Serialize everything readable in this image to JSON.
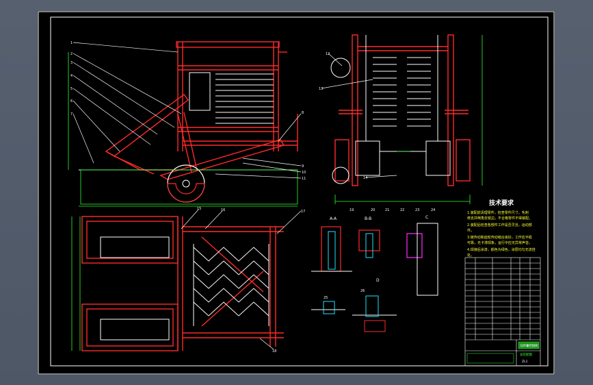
{
  "drawing": {
    "views": {
      "section_a": {
        "label": "A-A"
      },
      "section_b": {
        "label": "B-B"
      },
      "detail_c": {
        "label": "C"
      },
      "detail_d": {
        "label": "D"
      }
    },
    "notes": {
      "title": "技术要求",
      "lines": [
        "1.装配前清理零件，检查零件尺寸，毛刺",
        "修去并倒角去锐边，不合格零件不得装配。",
        "2.装配后检查各部件工作是否灵活，运动部",
        "件。",
        "3.链传动和齿轮传动啮合良好，工作应平稳",
        "可靠，无卡滞现象，运行中应无异常声音。",
        "4.焊接后涂漆，颜色为绿色，涂层均匀无流挂",
        "处。"
      ]
    },
    "balloons": [
      "1",
      "2",
      "3",
      "4",
      "5",
      "6",
      "7",
      "8",
      "9",
      "10",
      "11",
      "12",
      "13",
      "14",
      "15",
      "16",
      "17",
      "18",
      "19",
      "20",
      "21",
      "22",
      "23",
      "24",
      "25",
      "26"
    ],
    "title_block": {
      "title_1": "马铃薯挖掘机",
      "title_2": "总装配图",
      "sheet_no": "ZL1"
    },
    "colors": {
      "frame": "#ffffff",
      "structure": "#ff2a2a",
      "outline": "#ffffff",
      "dim": "#2cff2c",
      "leader": "#ffffff",
      "hatch": "#ff2cff",
      "cyan": "#22e0ff",
      "yellow": "#ffff33"
    }
  }
}
